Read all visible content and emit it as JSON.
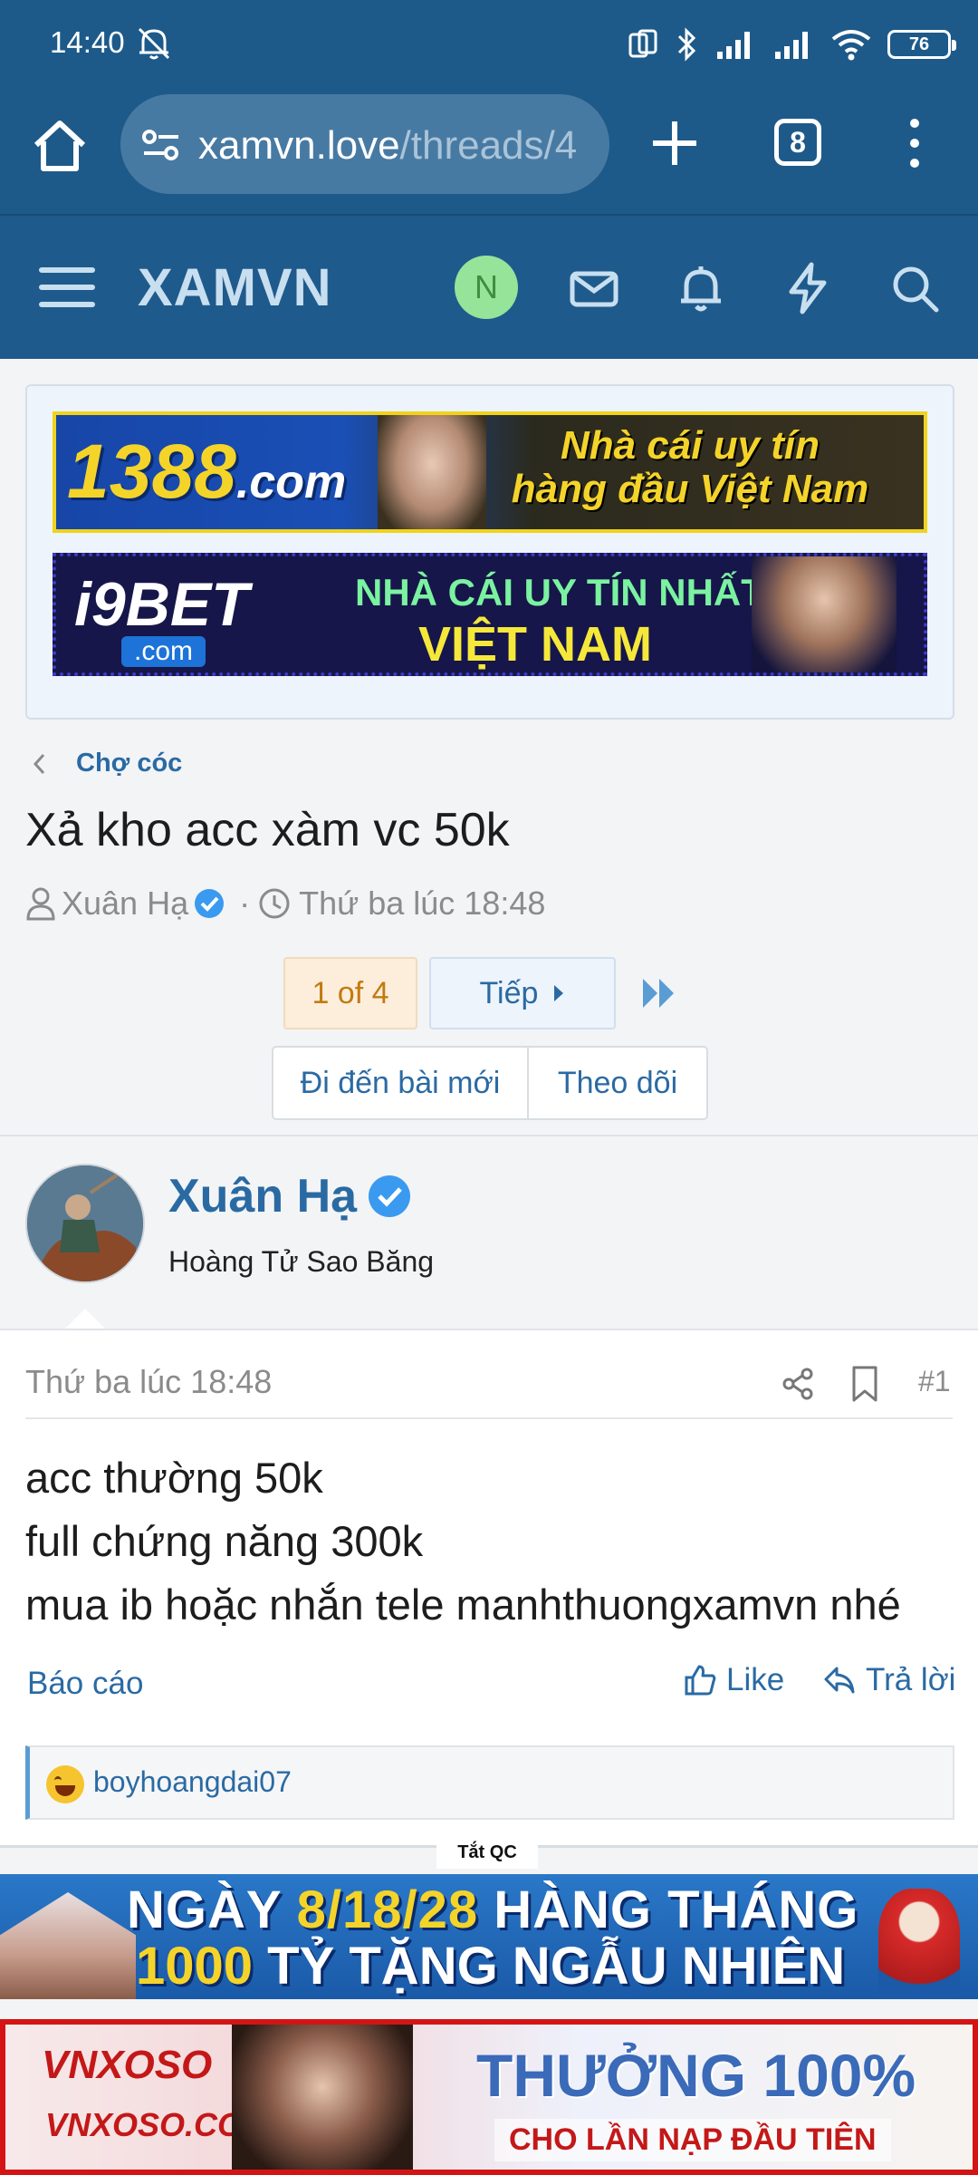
{
  "status_bar": {
    "time": "14:40",
    "battery": "76",
    "icons": [
      "mute-alarm-icon",
      "nfc-icon",
      "bluetooth-icon",
      "signal-icon",
      "signal-icon",
      "wifi-icon",
      "battery-icon"
    ]
  },
  "browser": {
    "url_host": "xamvn.love",
    "url_path": "/threads/4",
    "tab_count": "8"
  },
  "site": {
    "logo": "XAMVN",
    "user_initial": "N",
    "colors": {
      "header": "#1f5a8c",
      "accent": "#2a6aa3",
      "avatar": "#96e39a"
    }
  },
  "ads_top": {
    "banner1": {
      "brand": "1388",
      "brand_suffix": ".com",
      "slogan_line1": "Nhà cái uy tín",
      "slogan_line2": "hàng đầu Việt Nam"
    },
    "banner2": {
      "brand": "i9BET",
      "brand_suffix": ".com",
      "line1": "NHÀ CÁI UY TÍN NHẤT",
      "line2": "VIỆT NAM"
    }
  },
  "thread": {
    "breadcrumb": "Chợ cóc",
    "title": "Xả kho acc xàm vc 50k",
    "author": "Xuân Hạ",
    "separator": "·",
    "time": "Thứ ba lúc 18:48"
  },
  "pagination": {
    "current": "1 of 4",
    "next_label": "Tiếp"
  },
  "actions": {
    "goto_new": "Đi đến bài mới",
    "watch": "Theo dõi"
  },
  "post": {
    "username": "Xuân Hạ",
    "user_title": "Hoàng Tử Sao Băng",
    "date": "Thứ ba lúc 18:48",
    "number": "#1",
    "lines": [
      "acc thường 50k",
      "full chứng năng 300k",
      "mua ib hoặc nhắn tele manhthuongxamvn nhé"
    ],
    "report": "Báo cáo",
    "like": "Like",
    "reply": "Trả lời",
    "reaction_user": "boyhoangdai07"
  },
  "ads_bottom": {
    "close_label": "Tắt QC",
    "banner1": {
      "line1_a": "NGÀY ",
      "line1_b": "8/18/28",
      "line1_c": " HÀNG THÁNG",
      "line2_a": "1000",
      "line2_b": " TỶ TẶNG NGẪU NHIÊN"
    },
    "banner2": {
      "brand": "VNXOSO",
      "url": "VNXOSO.COM",
      "line1": "THƯỞNG 100%",
      "line2": "CHO LẦN NẠP ĐẦU TIÊN"
    }
  }
}
